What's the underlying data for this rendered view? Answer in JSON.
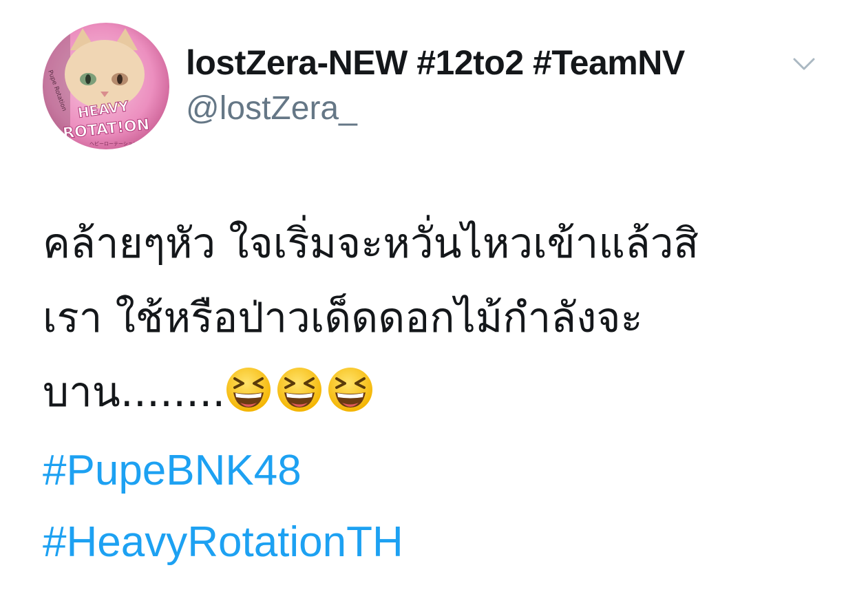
{
  "author": {
    "display_name": "lostZera-NEW #12to2 #TeamNV",
    "handle": "@lostZera_",
    "avatar": {
      "label_line1": "HEAVY",
      "label_line2": "ROTAT!ON",
      "side_text": "Pupe Rotation",
      "small_text": "ヘビーローテーション"
    }
  },
  "menu": {
    "icon": "chevron-down-icon"
  },
  "tweet": {
    "text_line1": "คล้ายๆหัว ใจเริ่มจะหวั่นไหวเข้าแล้วสิ",
    "text_line2": "เรา ใช้หรือป่าวเด็ดดอกไม้กำลังจะ",
    "text_line3": "บาน........",
    "emoji_name": "grinning-squinting-face",
    "emoji_count": 3,
    "hashtags": [
      "#PupeBNK48",
      "#HeavyRotationTH"
    ]
  },
  "colors": {
    "text": "#14171a",
    "secondary": "#657786",
    "link": "#1da1f2",
    "avatar_bg": "#f3a6cf"
  }
}
